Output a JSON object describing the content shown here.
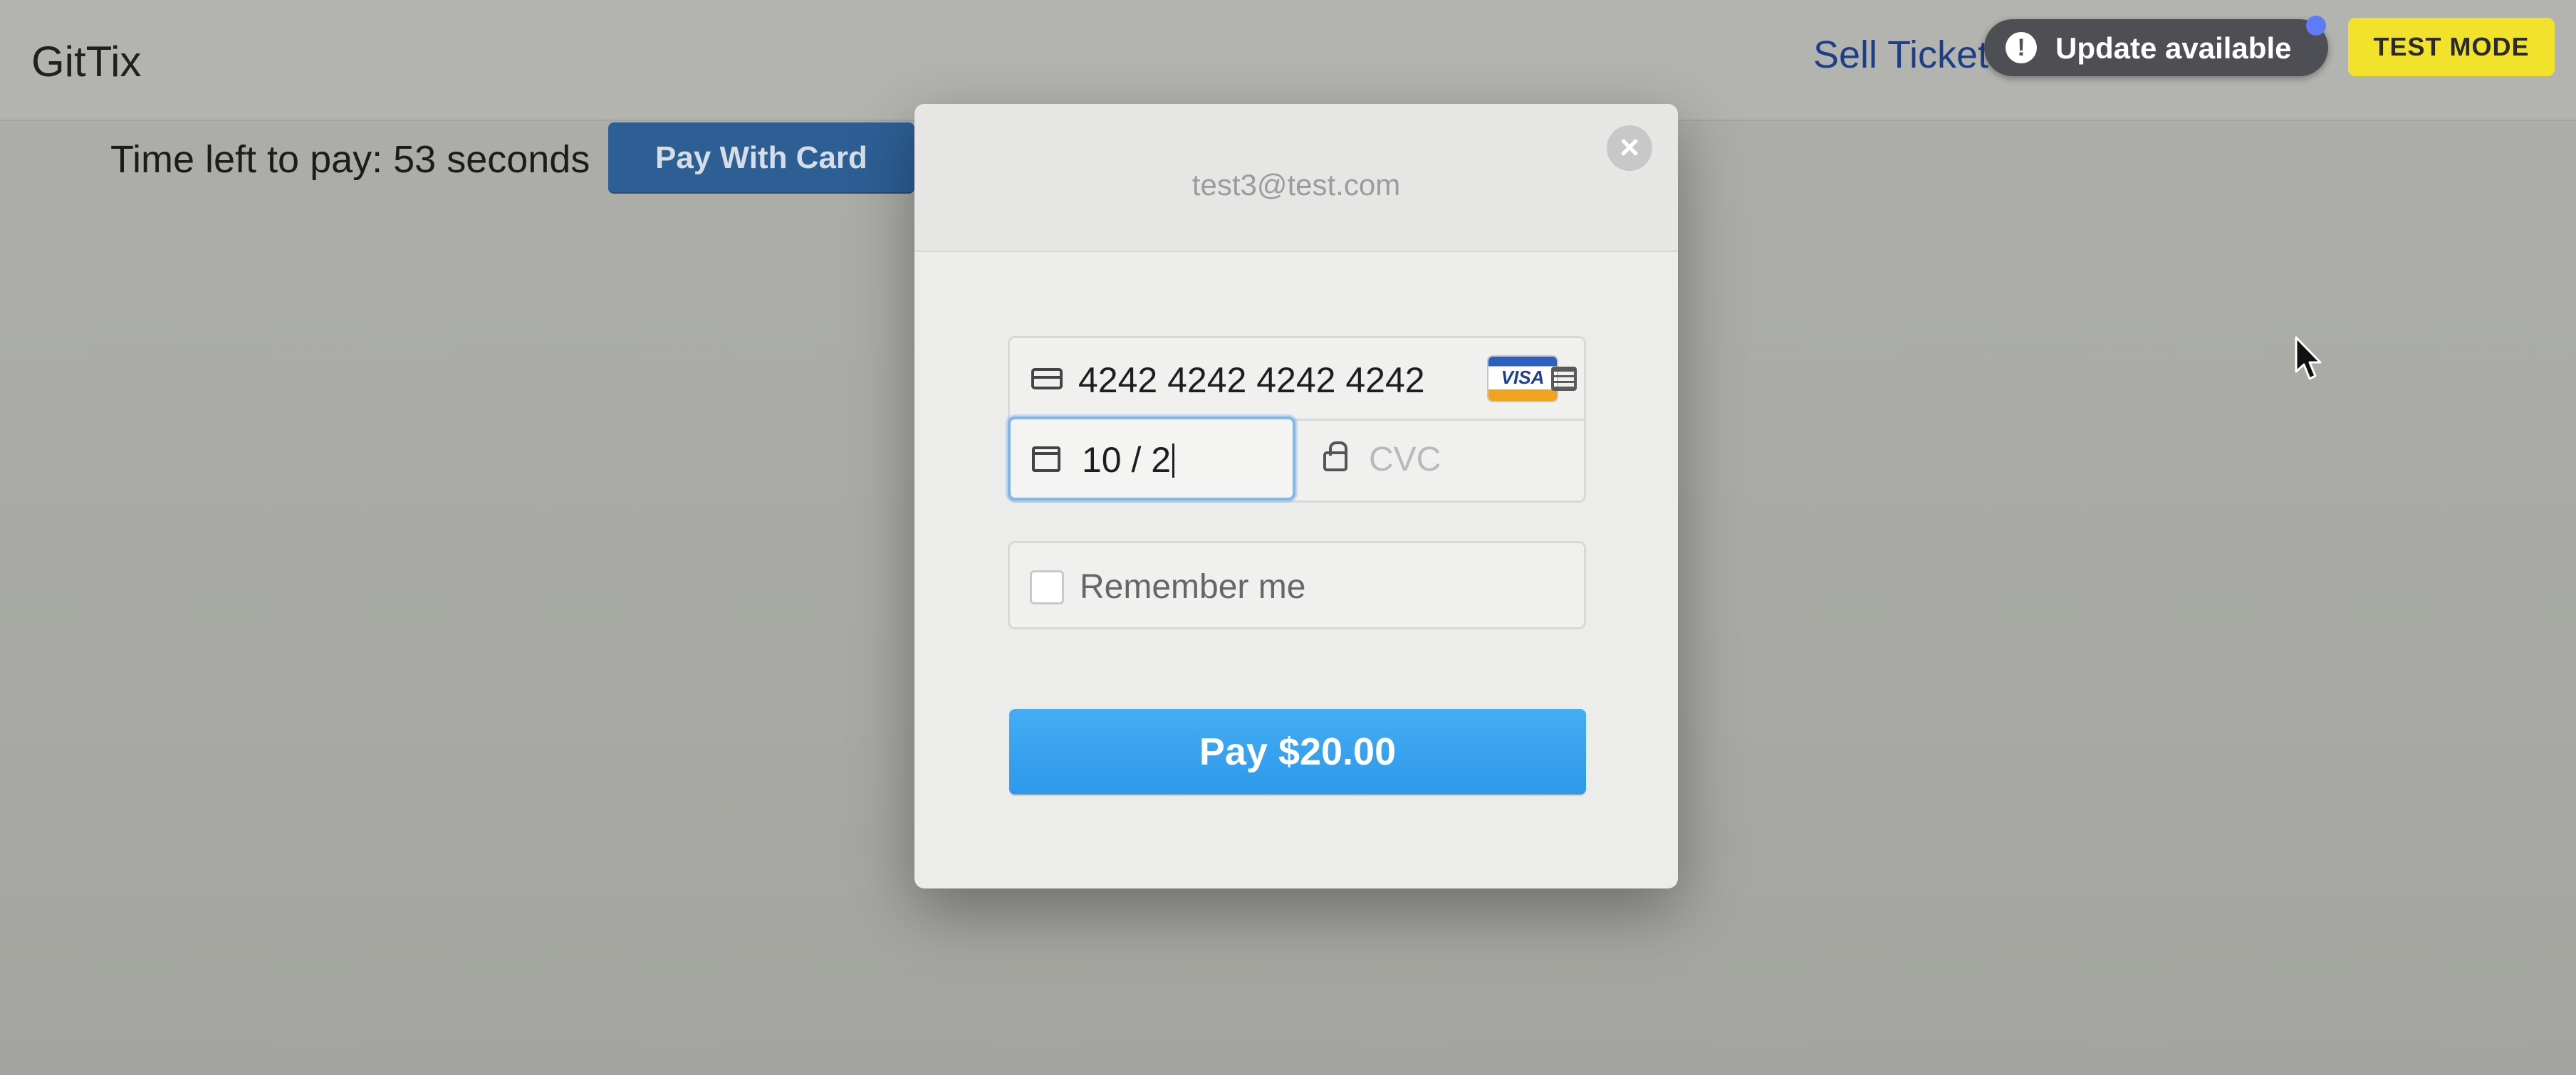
{
  "app": {
    "brand": "GitTix",
    "nav_link": "Sell Tickets"
  },
  "page": {
    "timer_text": "Time left to pay: 53 seconds",
    "pay_with_card_label": "Pay With Card"
  },
  "system": {
    "update_label": "Update available",
    "update_icon": "!",
    "test_mode_label": "TEST MODE"
  },
  "modal": {
    "email": "test3@test.com",
    "close_symbol": "×",
    "card_number": "4242 4242 4242 4242",
    "card_brand": "VISA",
    "expiry_value": "10 / 2",
    "cvc_placeholder": "CVC",
    "remember_label": "Remember me",
    "pay_button_label": "Pay $20.00"
  },
  "colors": {
    "pay_button": "#2e98ea",
    "test_mode": "#f3e22b",
    "focus_ring": "#7fb6f0"
  },
  "icons": [
    "card-icon",
    "visa-logo-icon",
    "card-scan-icon",
    "calendar-icon",
    "lock-icon",
    "alert-icon",
    "close-icon",
    "mouse-cursor-icon"
  ]
}
